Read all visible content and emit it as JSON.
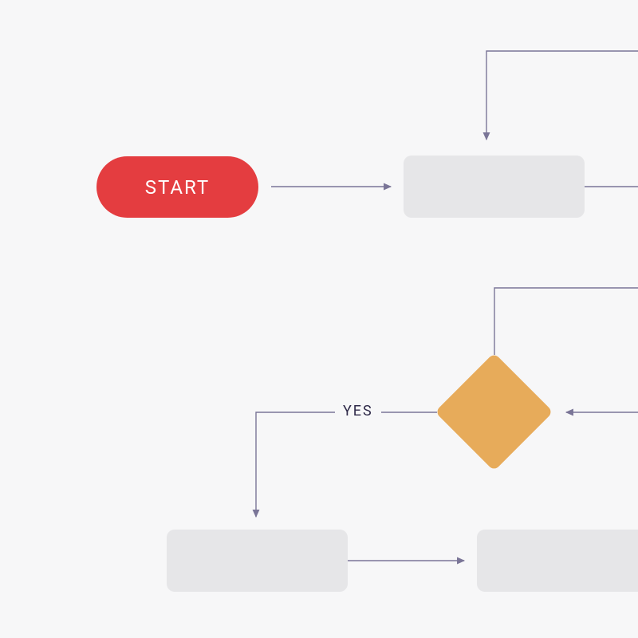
{
  "flowchart": {
    "nodes": {
      "start": {
        "label": "START",
        "type": "terminator"
      },
      "process_top": {
        "label": "",
        "type": "process"
      },
      "decision": {
        "label": "",
        "type": "decision"
      },
      "process_bottom_left": {
        "label": "",
        "type": "process"
      },
      "process_bottom_right": {
        "label": "",
        "type": "process"
      }
    },
    "edges": {
      "yes": {
        "label": "YES"
      }
    },
    "colors": {
      "start_fill": "#e43d40",
      "decision_fill": "#e7ab5a",
      "process_fill": "#e6e6e8",
      "connector": "#7a7597",
      "canvas": "#f7f7f8"
    }
  }
}
